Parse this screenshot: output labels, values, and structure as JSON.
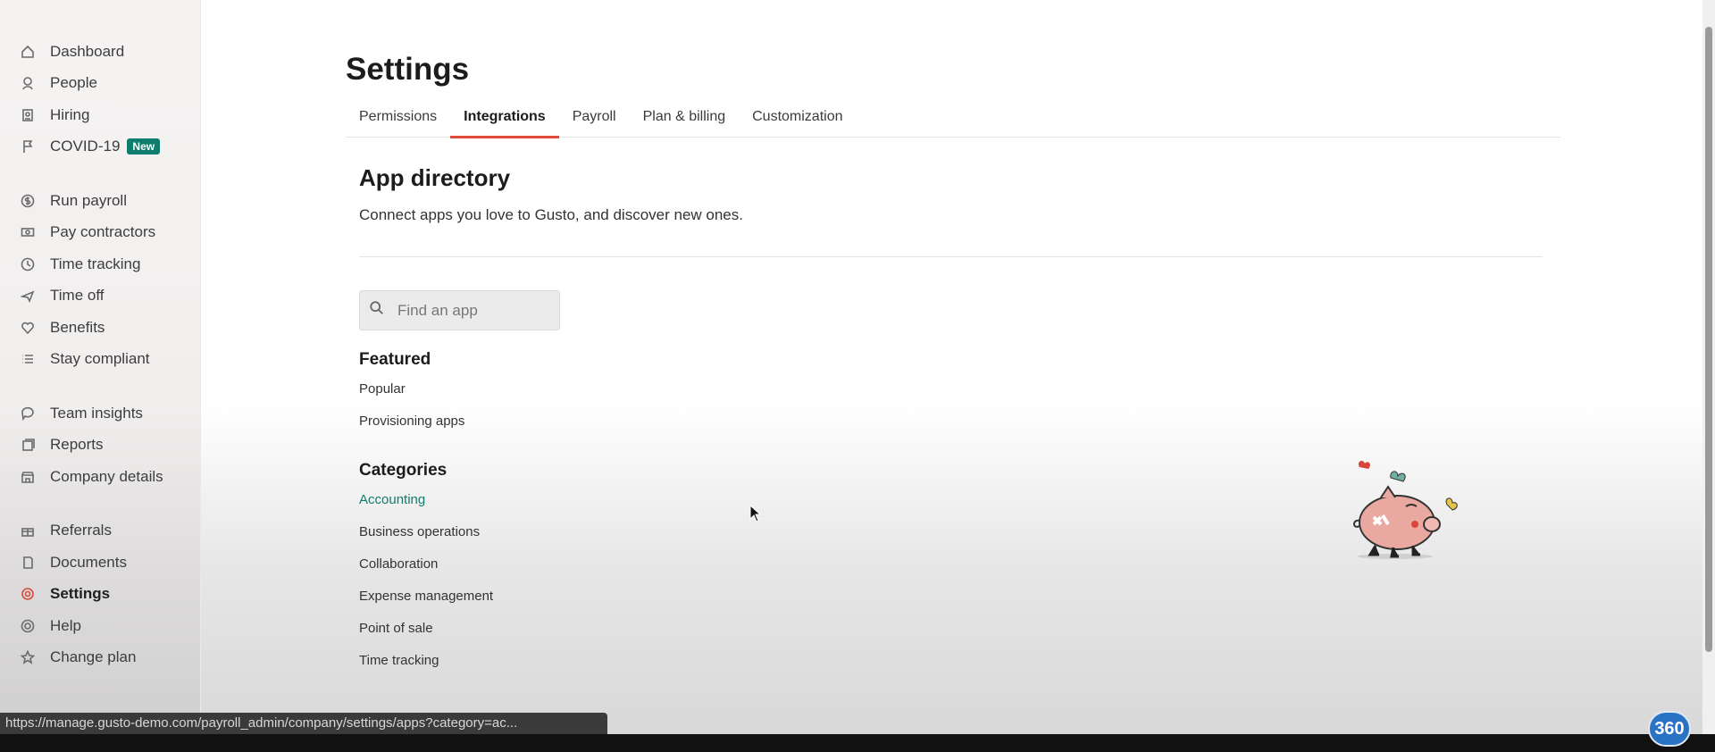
{
  "sidebar": {
    "groups": [
      [
        {
          "label": "Dashboard",
          "icon": "home-icon"
        },
        {
          "label": "People",
          "icon": "people-icon"
        },
        {
          "label": "Hiring",
          "icon": "hiring-icon"
        },
        {
          "label": "COVID-19",
          "icon": "flag-icon",
          "badge": "New"
        }
      ],
      [
        {
          "label": "Run payroll",
          "icon": "dollar-icon"
        },
        {
          "label": "Pay contractors",
          "icon": "cash-icon"
        },
        {
          "label": "Time tracking",
          "icon": "clock-icon"
        },
        {
          "label": "Time off",
          "icon": "plane-icon"
        },
        {
          "label": "Benefits",
          "icon": "heart-icon"
        },
        {
          "label": "Stay compliant",
          "icon": "list-icon"
        }
      ],
      [
        {
          "label": "Team insights",
          "icon": "chat-icon"
        },
        {
          "label": "Reports",
          "icon": "reports-icon"
        },
        {
          "label": "Company details",
          "icon": "building-icon"
        }
      ],
      [
        {
          "label": "Referrals",
          "icon": "gift-icon"
        },
        {
          "label": "Documents",
          "icon": "document-icon"
        },
        {
          "label": "Settings",
          "icon": "gear-icon",
          "active": true
        },
        {
          "label": "Help",
          "icon": "help-icon"
        },
        {
          "label": "Change plan",
          "icon": "star-icon"
        }
      ]
    ]
  },
  "page": {
    "title": "Settings",
    "tabs": [
      "Permissions",
      "Integrations",
      "Payroll",
      "Plan & billing",
      "Customization"
    ],
    "active_tab": "Integrations"
  },
  "directory": {
    "title": "App directory",
    "description": "Connect apps you love to Gusto, and discover new ones.",
    "search_placeholder": "Find an app",
    "featured": {
      "heading": "Featured",
      "items": [
        "Popular",
        "Provisioning apps"
      ]
    },
    "categories": {
      "heading": "Categories",
      "items": [
        "Accounting",
        "Business operations",
        "Collaboration",
        "Expense management",
        "Point of sale",
        "Time tracking"
      ],
      "active": "Accounting"
    }
  },
  "status_url": "https://manage.gusto-demo.com/payroll_admin/company/settings/apps?category=ac...",
  "watermark": "360",
  "colors": {
    "accent_red": "#e04a36",
    "accent_green": "#0f7d6e"
  }
}
